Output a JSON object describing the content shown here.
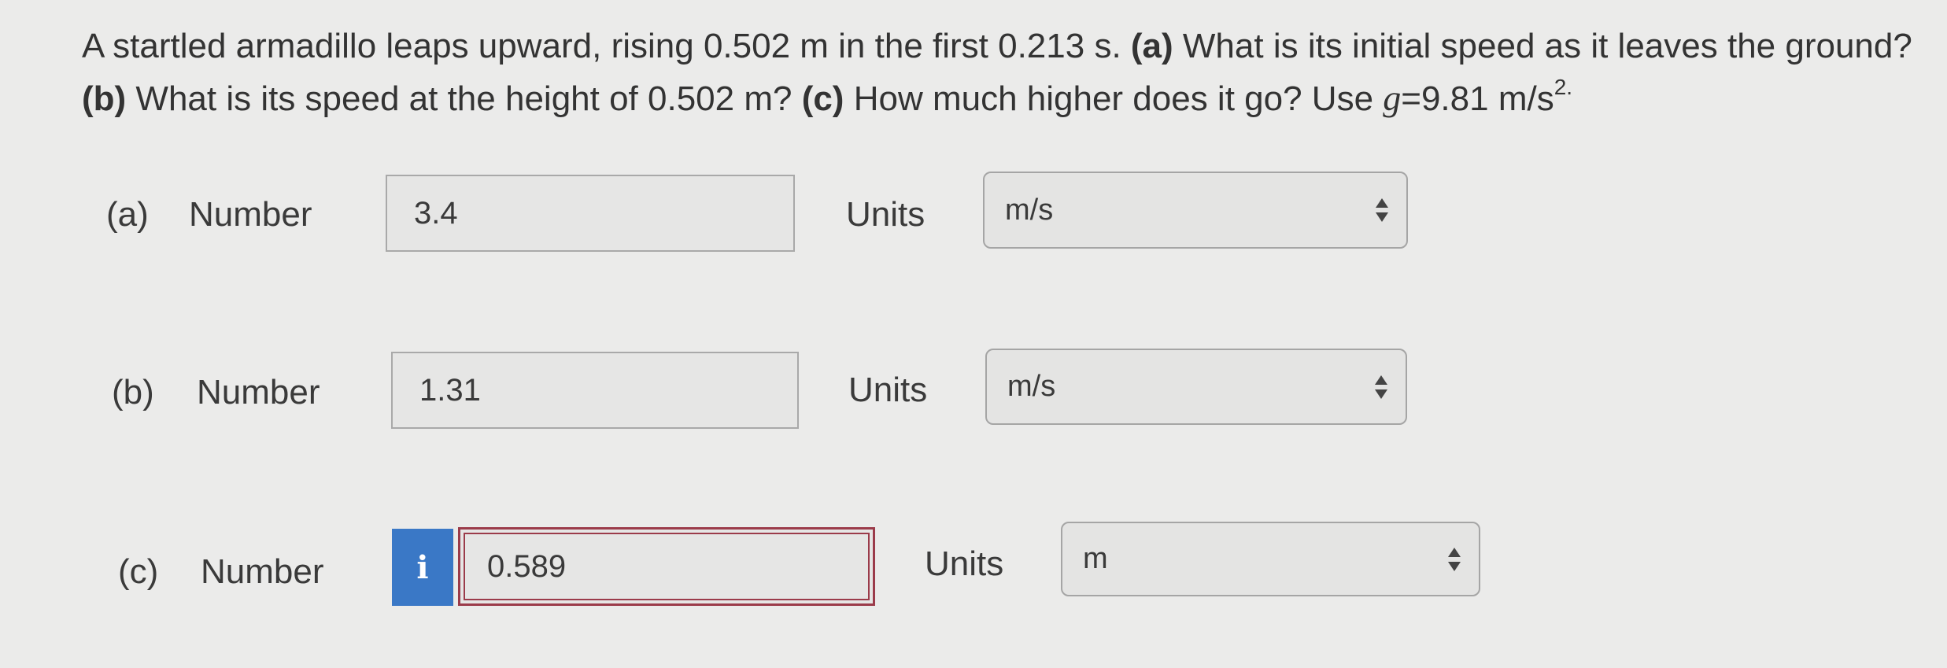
{
  "question": {
    "text_1": "A startled armadillo leaps upward, rising 0.502 m in the first 0.213 s. ",
    "a_tag": "(a)",
    "text_2": " What is its initial speed as it leaves the ground? ",
    "b_tag": "(b)",
    "text_3": " What is its speed at the height of 0.502 m? ",
    "c_tag": "(c)",
    "text_4": " How much higher does it go? Use ",
    "g_symbol": "g",
    "text_5": "=9.81 m/s",
    "exponent": "2."
  },
  "parts": [
    {
      "label": "(a)",
      "number_label": "Number",
      "value": "3.4",
      "units_label": "Units",
      "unit": "m/s"
    },
    {
      "label": "(b)",
      "number_label": "Number",
      "value": "1.31",
      "units_label": "Units",
      "unit": "m/s"
    },
    {
      "label": "(c)",
      "number_label": "Number",
      "info_icon": "i",
      "value": "0.589",
      "units_label": "Units",
      "unit": "m"
    }
  ],
  "icons": {
    "info": "info-icon",
    "select_arrows": "up-down-arrows-icon"
  },
  "colors": {
    "background": "#ebebea",
    "info_button": "#3a78c6",
    "error_border": "#9b3b4a",
    "text": "#3a3a3a"
  }
}
